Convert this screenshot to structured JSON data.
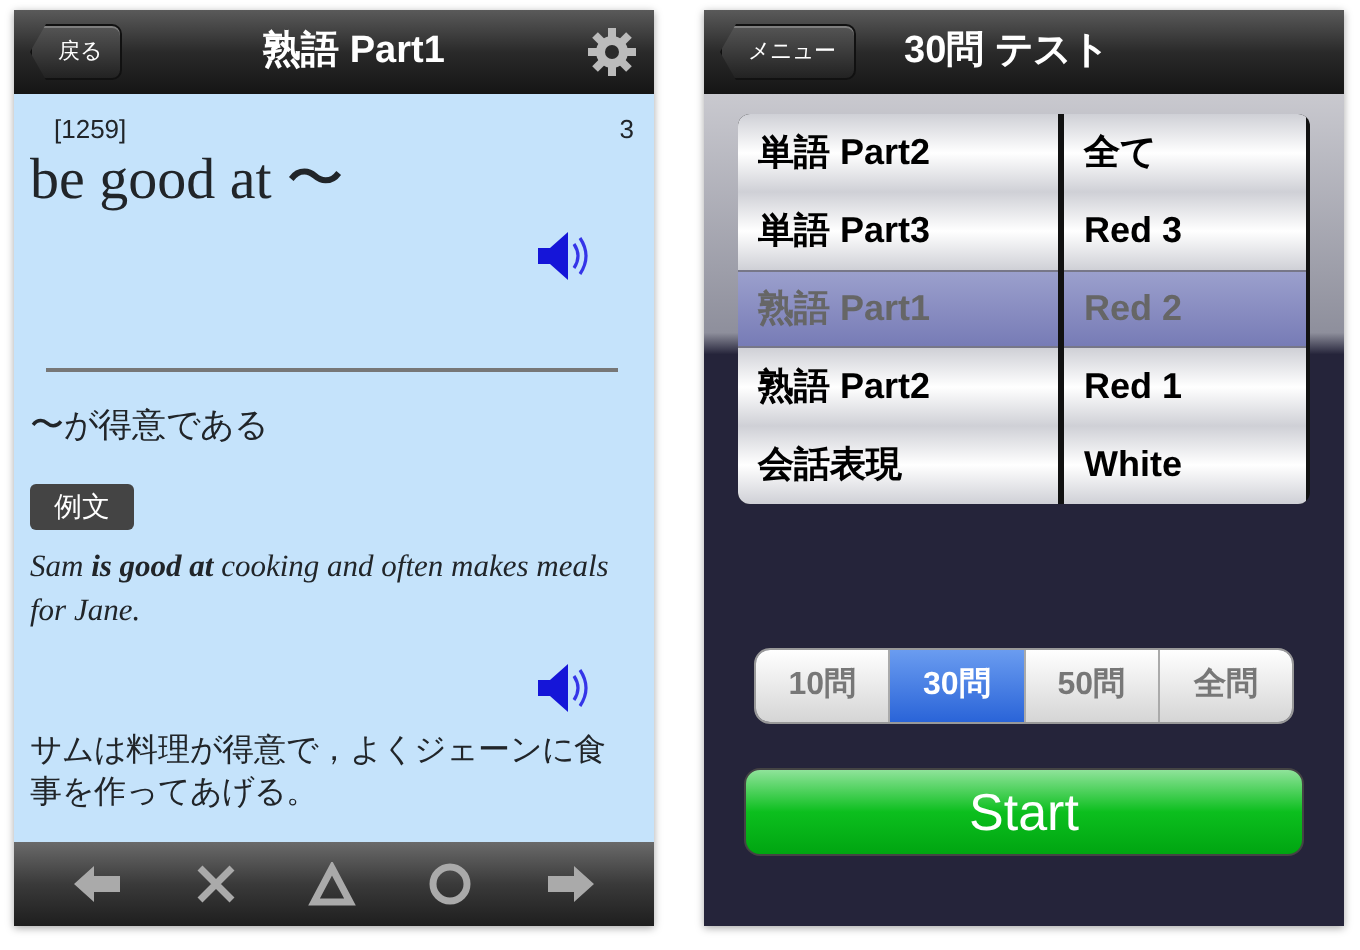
{
  "card_screen": {
    "nav": {
      "back": "戻る",
      "title": "熟語 Part1"
    },
    "entry_number": "[1259]",
    "count": "3",
    "headword": "be good at 〜",
    "meaning": "〜が得意である",
    "example_label": "例文",
    "example": "Sam **is good at** cooking and often makes meals for Jane.",
    "translation": "サムは料理が得意で，よくジェーンに食事を作ってあげる。"
  },
  "test_screen": {
    "nav": {
      "back": "メニュー",
      "title": "30問 テスト"
    },
    "picker": [
      {
        "rows": [
          {
            "label": "単語 Part2",
            "selected": false
          },
          {
            "label": "単語 Part3",
            "selected": false
          },
          {
            "label": "熟語 Part1",
            "selected": true
          },
          {
            "label": "熟語 Part2",
            "selected": false
          },
          {
            "label": "会話表現",
            "selected": false
          }
        ]
      },
      {
        "rows": [
          {
            "label": "全て",
            "selected": false
          },
          {
            "label": "Red 3",
            "selected": false
          },
          {
            "label": "Red 2",
            "selected": true
          },
          {
            "label": "Red 1",
            "selected": false
          },
          {
            "label": "White",
            "selected": false
          }
        ]
      }
    ],
    "segments": [
      {
        "label": "10問",
        "selected": false
      },
      {
        "label": "30問",
        "selected": true
      },
      {
        "label": "50問",
        "selected": false
      },
      {
        "label": "全問",
        "selected": false
      }
    ],
    "start_button": "Start"
  }
}
